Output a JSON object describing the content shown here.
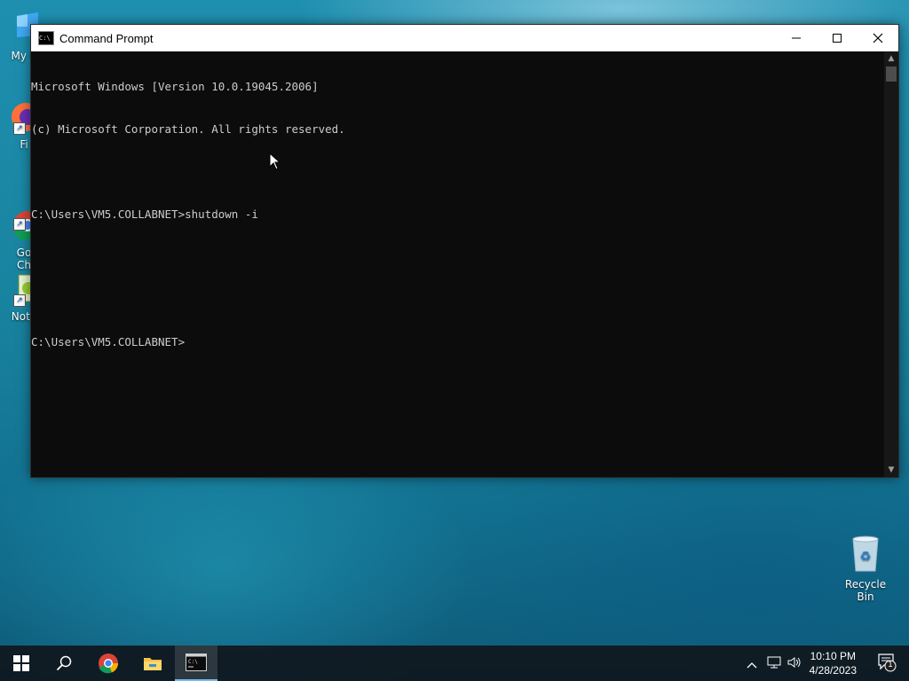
{
  "desktop": {
    "icons": [
      {
        "label": "My Co",
        "icon": "computer-icon"
      },
      {
        "label": "Fi",
        "icon": "firefox-icon"
      },
      {
        "label": "Go\nCh",
        "icon": "chrome-icon"
      },
      {
        "label": "Note",
        "icon": "notepad-icon"
      }
    ],
    "recycle_bin_label": "Recycle Bin"
  },
  "window": {
    "title": "Command Prompt",
    "controls": {
      "minimize": "—",
      "maximize": "☐",
      "close": "✕"
    },
    "console_lines": [
      "Microsoft Windows [Version 10.0.19045.2006]",
      "(c) Microsoft Corporation. All rights reserved.",
      "",
      "C:\\Users\\VM5.COLLABNET>shutdown -i",
      "",
      "",
      "C:\\Users\\VM5.COLLABNET>"
    ],
    "background_color": "#0c0c0c",
    "text_color": "#cccccc"
  },
  "taskbar": {
    "buttons": [
      "start-icon",
      "search-icon",
      "chrome-icon",
      "file-explorer-icon",
      "command-prompt-icon"
    ],
    "active": "command-prompt-icon",
    "clock": {
      "time": "10:10 PM",
      "date": "4/28/2023"
    },
    "notification_count": "1",
    "accent_color": "#76b9ed"
  }
}
